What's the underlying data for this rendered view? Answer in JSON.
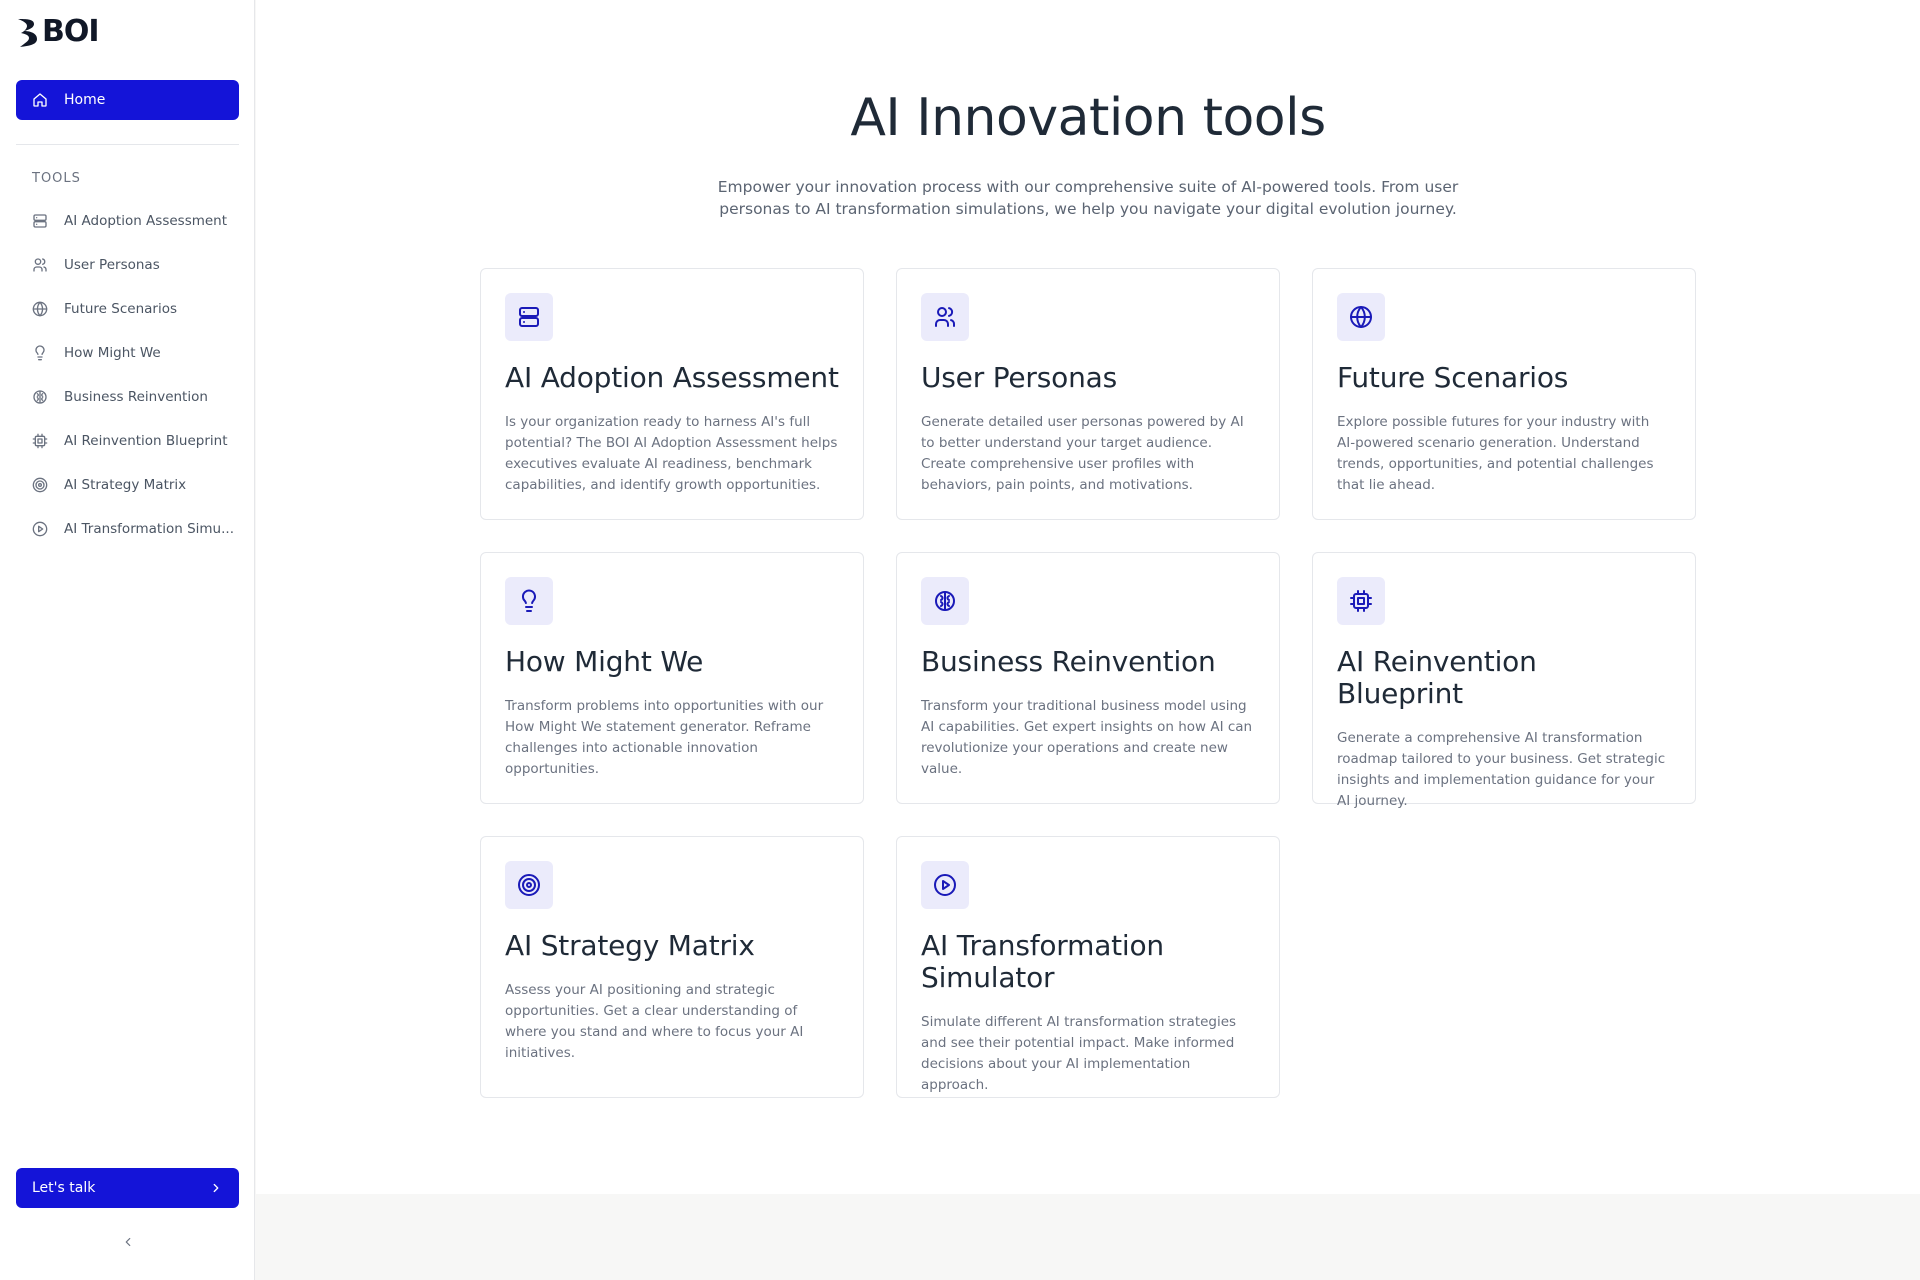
{
  "brand": {
    "name": "BOI"
  },
  "sidebar": {
    "home_label": "Home",
    "section_label": "TOOLS",
    "items": [
      {
        "label": "AI Adoption Assessment",
        "icon": "database-icon"
      },
      {
        "label": "User Personas",
        "icon": "users-icon"
      },
      {
        "label": "Future Scenarios",
        "icon": "globe-icon"
      },
      {
        "label": "How Might We",
        "icon": "lightbulb-icon"
      },
      {
        "label": "Business Reinvention",
        "icon": "brain-icon"
      },
      {
        "label": "AI Reinvention Blueprint",
        "icon": "cpu-icon"
      },
      {
        "label": "AI Strategy Matrix",
        "icon": "target-icon"
      },
      {
        "label": "AI Transformation Simu...",
        "icon": "play-circle-icon"
      }
    ],
    "cta_label": "Let's talk"
  },
  "main": {
    "title": "AI Innovation tools",
    "subtitle": "Empower your innovation process with our comprehensive suite of AI-powered tools. From user personas to AI transformation simulations, we help you navigate your digital evolution journey.",
    "cards": [
      {
        "title": "AI Adoption Assessment",
        "description": "Is your organization ready to harness AI's full potential? The BOI AI Adoption Assessment helps executives evaluate AI readiness, benchmark capabilities, and identify growth opportunities.",
        "icon": "database-icon"
      },
      {
        "title": "User Personas",
        "description": "Generate detailed user personas powered by AI to better understand your target audience. Create comprehensive user profiles with behaviors, pain points, and motivations.",
        "icon": "users-icon"
      },
      {
        "title": "Future Scenarios",
        "description": "Explore possible futures for your industry with AI-powered scenario generation. Understand trends, opportunities, and potential challenges that lie ahead.",
        "icon": "globe-icon"
      },
      {
        "title": "How Might We",
        "description": "Transform problems into opportunities with our How Might We statement generator. Reframe challenges into actionable innovation opportunities.",
        "icon": "lightbulb-icon"
      },
      {
        "title": "Business Reinvention",
        "description": "Transform your traditional business model using AI capabilities. Get expert insights on how AI can revolutionize your operations and create new value.",
        "icon": "brain-icon"
      },
      {
        "title": "AI Reinvention Blueprint",
        "description": "Generate a comprehensive AI transformation roadmap tailored to your business. Get strategic insights and implementation guidance for your AI journey.",
        "icon": "cpu-icon"
      },
      {
        "title": "AI Strategy Matrix",
        "description": "Assess your AI positioning and strategic opportunities. Get a clear understanding of where you stand and where to focus your AI initiatives.",
        "icon": "target-icon"
      },
      {
        "title": "AI Transformation Simulator",
        "description": "Simulate different AI transformation strategies and see their potential impact. Make informed decisions about your AI implementation approach.",
        "icon": "play-circle-icon"
      }
    ]
  },
  "colors": {
    "accent": "#1414d8",
    "icon_badge_bg": "#ebebfb",
    "icon_color": "#1a1ab8"
  }
}
